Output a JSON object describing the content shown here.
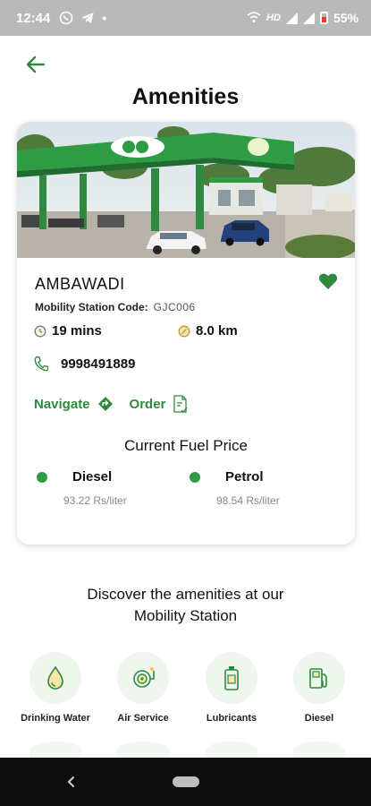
{
  "status_bar": {
    "time": "12:44",
    "network_label": "HD",
    "battery": "55%"
  },
  "header": {
    "title": "Amenities",
    "back_icon": "arrow-left-icon"
  },
  "station": {
    "name": "AMBAWADI",
    "code_label": "Mobility Station Code:",
    "code": "GJC006",
    "time": "19 mins",
    "distance": "8.0 km",
    "phone": "9998491889",
    "favorite": true
  },
  "actions": {
    "navigate_label": "Navigate",
    "order_label": "Order"
  },
  "fuel": {
    "title": "Current Fuel Price",
    "items": [
      {
        "name": "Diesel",
        "price": "93.22 Rs/liter"
      },
      {
        "name": "Petrol",
        "price": "98.54 Rs/liter"
      }
    ]
  },
  "discover": {
    "line1": "Discover the amenities at our",
    "line2": "Mobility Station"
  },
  "amenities": [
    {
      "label": "Drinking Water",
      "icon": "water-drop-icon"
    },
    {
      "label": "Air Service",
      "icon": "air-pump-icon"
    },
    {
      "label": "Lubricants",
      "icon": "lubricant-can-icon"
    },
    {
      "label": "Diesel",
      "icon": "fuel-pump-icon"
    }
  ],
  "colors": {
    "accent_green": "#2e8b3e",
    "status_bar": "#b9b9b9",
    "favorite": "#2e8b3e"
  }
}
